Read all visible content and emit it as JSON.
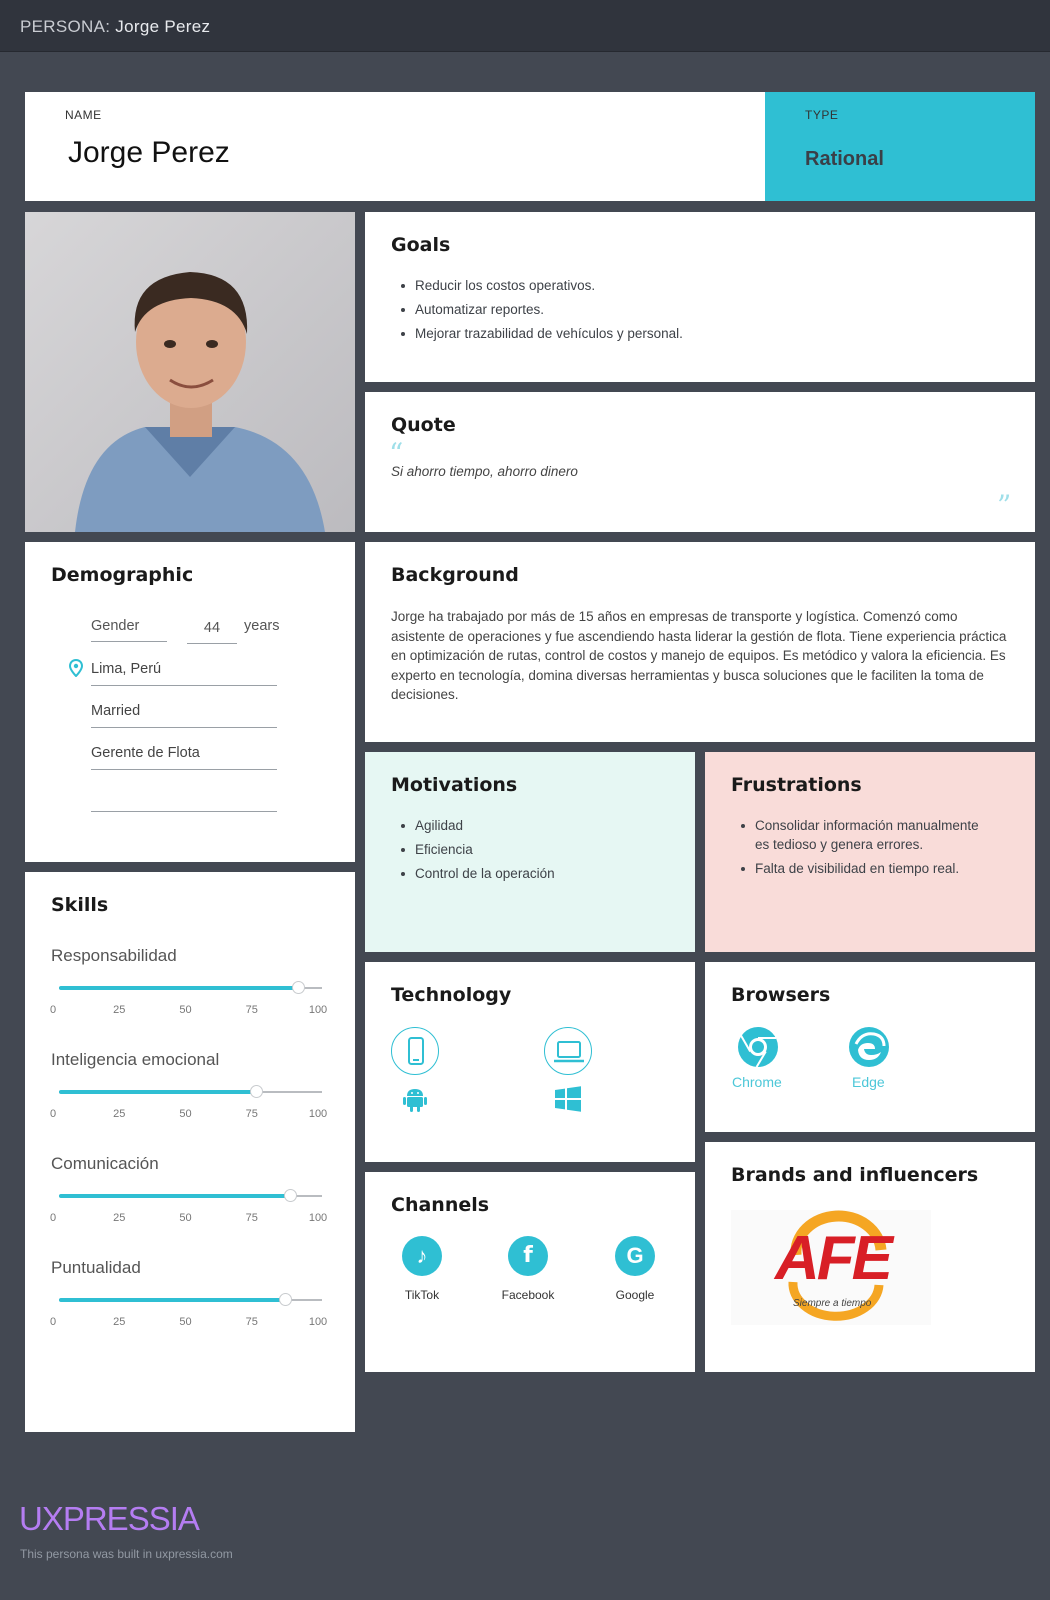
{
  "header": {
    "prefix": "PERSONA:",
    "name": "Jorge Perez"
  },
  "identity": {
    "name_label": "NAME",
    "name": "Jorge Perez",
    "type_label": "TYPE",
    "type": "Rational"
  },
  "goals": {
    "title": "Goals",
    "items": [
      "Reducir los costos operativos.",
      "Automatizar reportes.",
      "Mejorar trazabilidad de vehículos y personal."
    ]
  },
  "quote": {
    "title": "Quote",
    "text": "Si ahorro tiempo, ahorro dinero"
  },
  "demographic": {
    "title": "Demographic",
    "gender": "Gender",
    "age": "44",
    "age_unit": "years",
    "location": "Lima, Perú",
    "marital": "Married",
    "job": "Gerente de Flota",
    "extra": ""
  },
  "background": {
    "title": "Background",
    "text": "Jorge ha trabajado por más de 15 años en empresas de transporte y logística. Comenzó como asistente de operaciones y fue ascendiendo hasta liderar la gestión de flota. Tiene experiencia práctica en optimización de rutas, control de costos y manejo de equipos. Es metódico y valora la eficiencia. Es experto en tecnología, domina diversas herramientas y busca soluciones que le faciliten la toma de decisiones."
  },
  "motivations": {
    "title": "Motivations",
    "items": [
      "Agilidad",
      "Eficiencia",
      "Control de la operación"
    ]
  },
  "frustrations": {
    "title": "Frustrations",
    "items": [
      "Consolidar  información manualmente es tedioso y genera errores.",
      "Falta de visibilidad en tiempo real."
    ]
  },
  "skills": {
    "title": "Skills",
    "ticks": [
      "0",
      "25",
      "50",
      "75",
      "100"
    ],
    "items": [
      {
        "name": "Responsabilidad",
        "value": 91
      },
      {
        "name": "Inteligencia emocional",
        "value": 75
      },
      {
        "name": "Comunicación",
        "value": 88
      },
      {
        "name": "Puntualidad",
        "value": 86
      }
    ]
  },
  "technology": {
    "title": "Technology",
    "icons": [
      "mobile-icon",
      "laptop-icon",
      "android-icon",
      "windows-icon"
    ]
  },
  "browsers": {
    "title": "Browsers",
    "items": [
      "Chrome",
      "Edge"
    ]
  },
  "channels": {
    "title": "Channels",
    "items": [
      "TikTok",
      "Facebook",
      "Google"
    ]
  },
  "brands": {
    "title": "Brands and influencers",
    "logo_text": "AFE",
    "logo_tagline": "Siempre a tiempo"
  },
  "footer": {
    "brand": "UXPRESSIA",
    "note": "This persona was built in uxpressia.com"
  },
  "colors": {
    "accent": "#2fbfd3",
    "motivations_bg": "#e6f7f3",
    "frustrations_bg": "#f9dcd9",
    "page_bg": "#434852",
    "brand_purple": "#b57df2"
  }
}
